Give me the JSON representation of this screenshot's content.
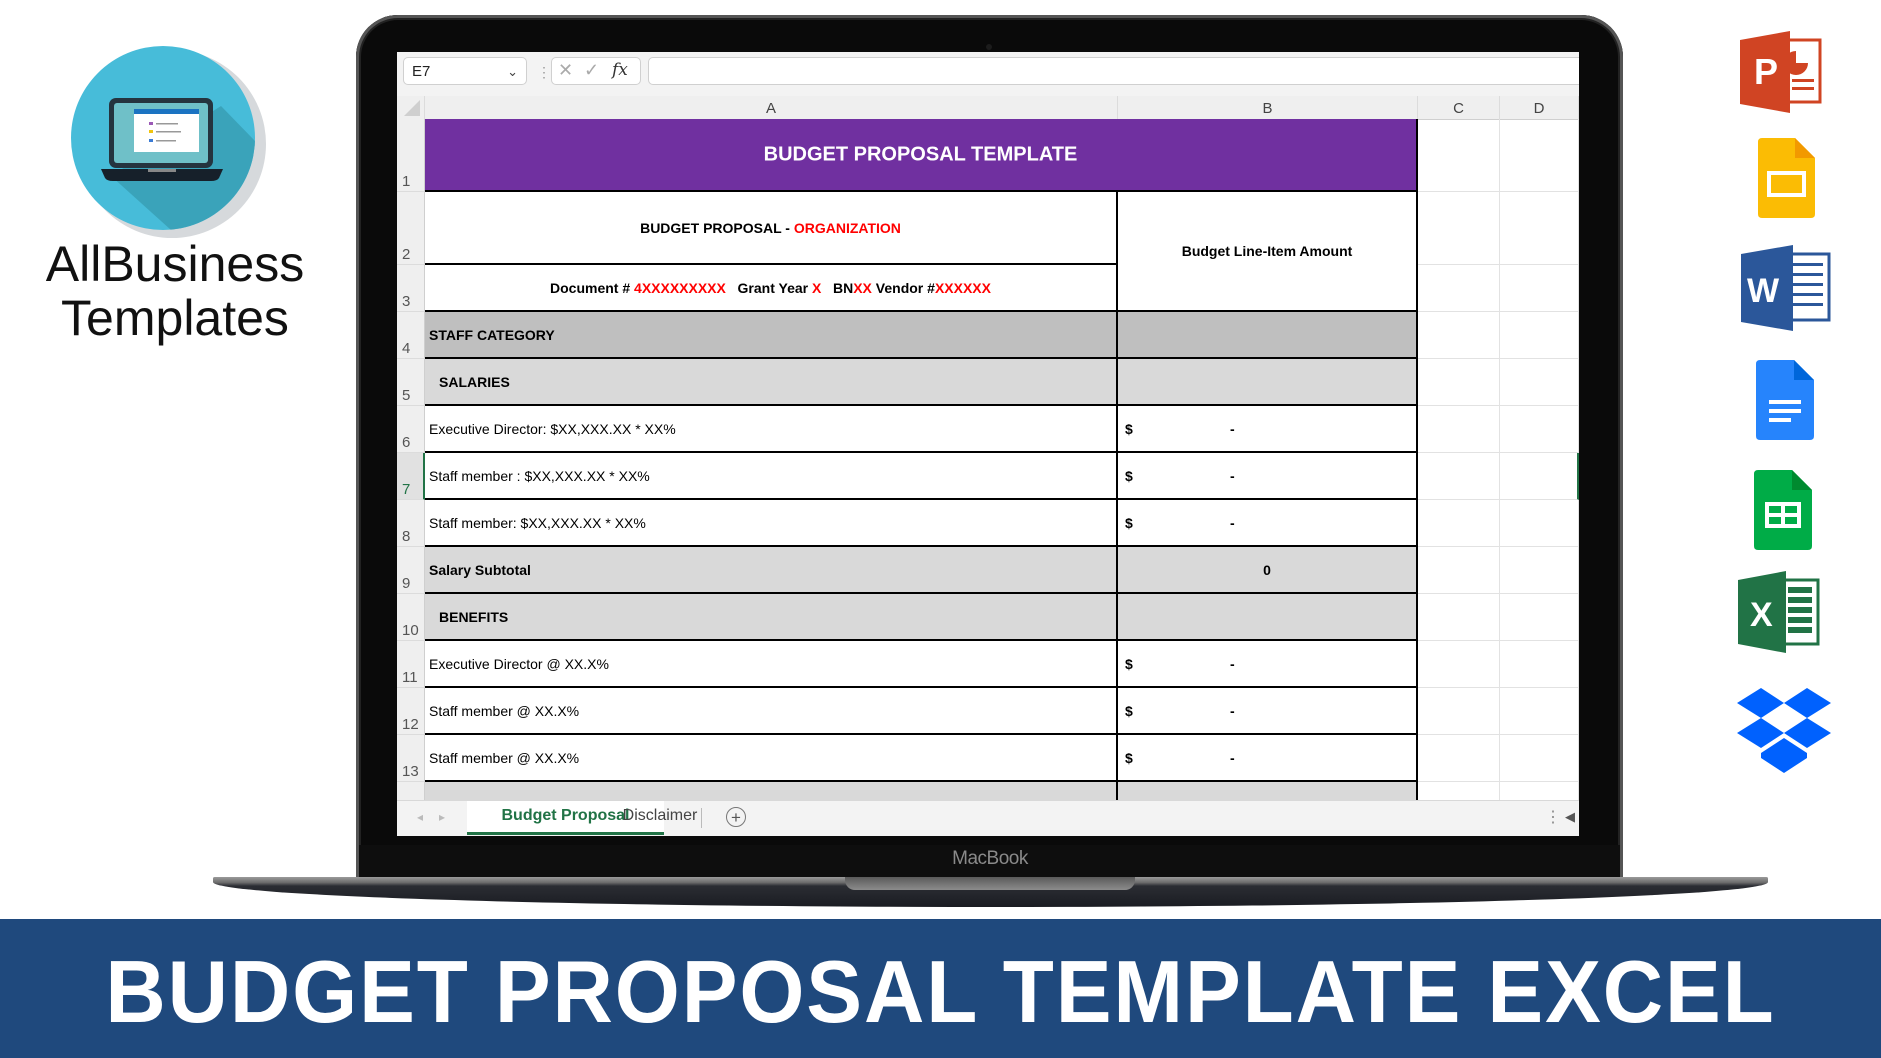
{
  "brand": {
    "line1": "AllBusiness",
    "line2": "Templates",
    "logo_icon": "laptop-list-icon"
  },
  "device": {
    "label": "MacBook"
  },
  "excel": {
    "name_box": "E7",
    "formula_bar": {
      "cancel_icon": "✕",
      "enter_icon": "✓",
      "function_icon": "fx",
      "value": ""
    },
    "columns": [
      "A",
      "B",
      "C",
      "D"
    ],
    "rows": [
      "1",
      "2",
      "3",
      "4",
      "5",
      "6",
      "7",
      "8",
      "9",
      "10",
      "11",
      "12",
      "13"
    ],
    "selected_cell": "E7",
    "sheet": {
      "title": "BUDGET PROPOSAL TEMPLATE",
      "header_prefix": "BUDGET PROPOSAL - ",
      "header_org": "ORGANIZATION",
      "doc_label": "Document # ",
      "doc_value": "4XXXXXXXXX",
      "grant_label": "   Grant Year ",
      "grant_value": "X",
      "bn_label": "   BN",
      "bn_value": "XX",
      "vendor_label": " Vendor #",
      "vendor_value": "XXXXXX",
      "amount_header": "Budget Line-Item Amount",
      "staff_category": "STAFF CATEGORY",
      "salaries": "SALARIES",
      "salary_items": [
        {
          "label": "Executive Director: $XX,XXX.XX * XX%",
          "currency": "$",
          "amount": "-"
        },
        {
          "label": "Staff member : $XX,XXX.XX * XX%",
          "currency": "$",
          "amount": "-"
        },
        {
          "label": "Staff member: $XX,XXX.XX * XX%",
          "currency": "$",
          "amount": "-"
        }
      ],
      "salary_subtotal_label": "Salary Subtotal",
      "salary_subtotal_value": "0",
      "benefits": "BENEFITS",
      "benefit_items": [
        {
          "label": "Executive Director @ XX.X%",
          "currency": "$",
          "amount": "-"
        },
        {
          "label": "Staff member @ XX.X%",
          "currency": "$",
          "amount": "-"
        },
        {
          "label": "Staff member @ XX.X%",
          "currency": "$",
          "amount": "-"
        }
      ]
    },
    "tabs": [
      {
        "label": "Budget Proposal template",
        "active": true
      },
      {
        "label": "Disclaimer",
        "active": false
      }
    ],
    "add_sheet_icon": "+",
    "colors": {
      "title_fill": "#7030a0",
      "category_fill": "#bfbfbf",
      "section_fill": "#d9d9d9",
      "accent_green": "#217346",
      "highlight_red": "#ff0000"
    }
  },
  "app_icons": [
    "powerpoint-icon",
    "google-slides-icon",
    "word-icon",
    "google-docs-icon",
    "google-sheets-icon",
    "excel-icon",
    "dropbox-icon"
  ],
  "banner": {
    "text": "BUDGET PROPOSAL TEMPLATE EXCEL",
    "color": "#1f497d"
  }
}
